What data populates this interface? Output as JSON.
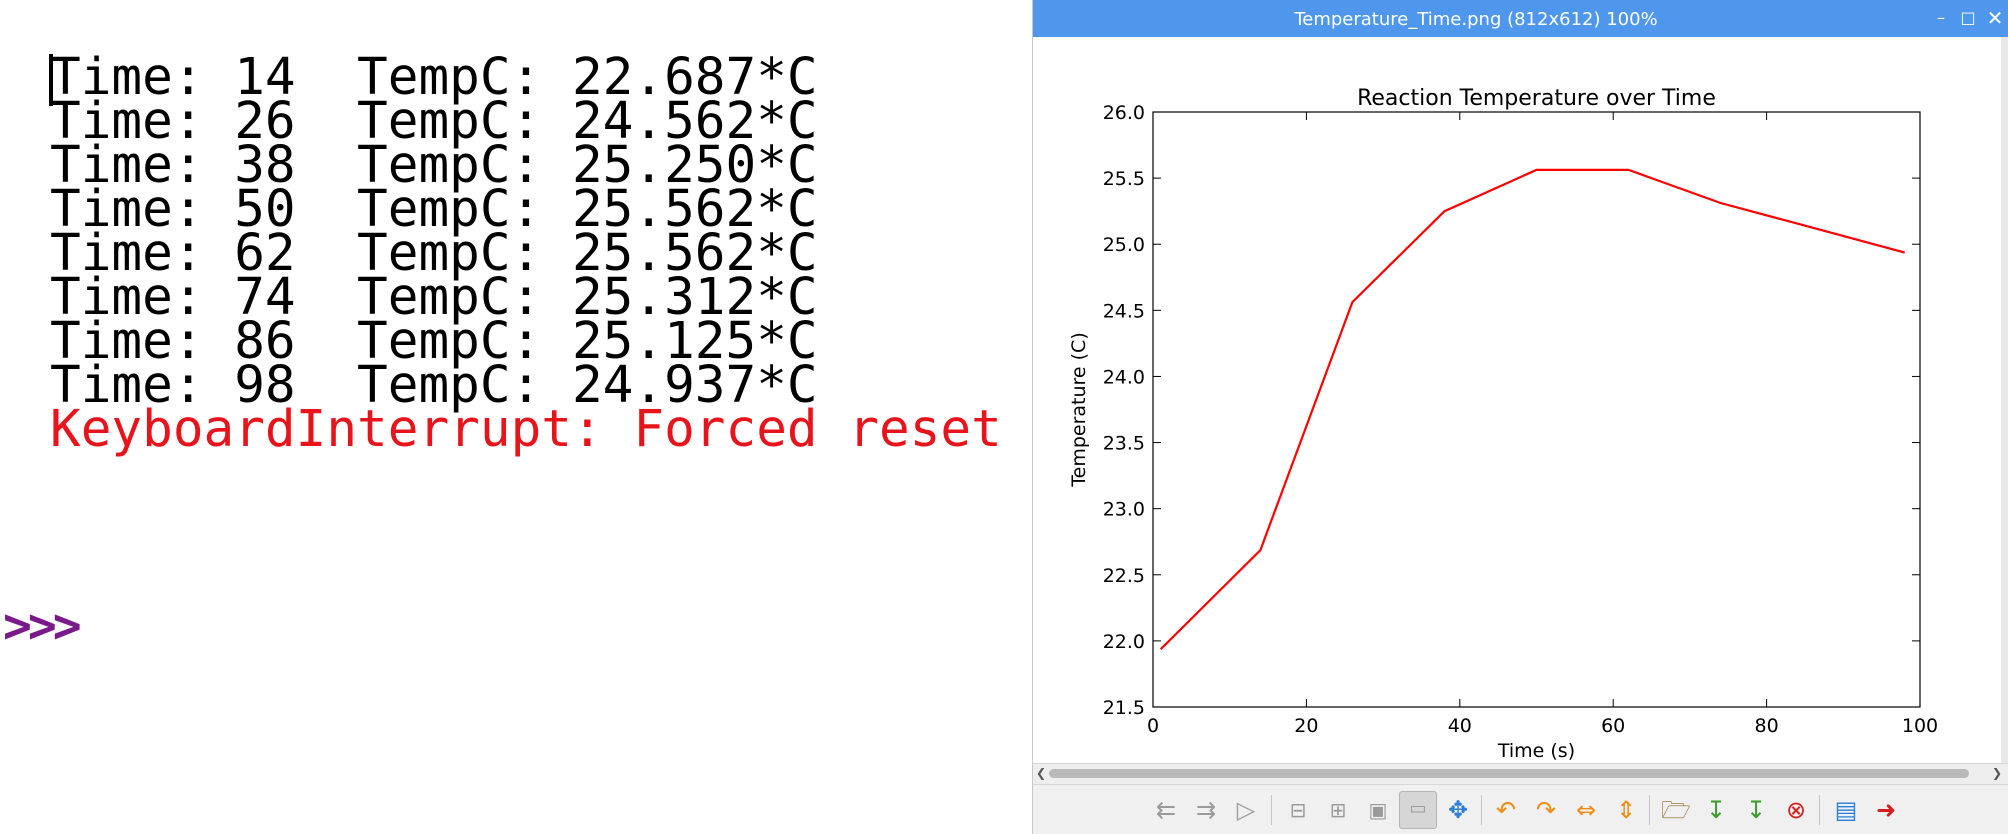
{
  "shell": {
    "lines": [
      "Time: 14  TempC: 22.687*C",
      "Time: 26  TempC: 24.562*C",
      "Time: 38  TempC: 25.250*C",
      "Time: 50  TempC: 25.562*C",
      "Time: 62  TempC: 25.562*C",
      "Time: 74  TempC: 25.312*C",
      "Time: 86  TempC: 25.125*C",
      "Time: 98  TempC: 24.937*C"
    ],
    "error": "KeyboardInterrupt: Forced reset",
    "prompt": ">>>",
    "colors": {
      "text": "#000000",
      "error": "#e8141c",
      "prompt": "#7a1a8a"
    }
  },
  "viewer": {
    "title": "Temperature_Time.png (812x612) 100%",
    "controls": {
      "minimize": "–",
      "maximize": "□",
      "close": "✕"
    },
    "titlebar_color": "#4e97ec",
    "toolbar": {
      "icons": [
        "previous-icon",
        "next-icon",
        "slideshow-icon",
        "zoom-out-icon",
        "zoom-in-icon",
        "zoom-fit-icon",
        "original-size-icon",
        "fullscreen-icon",
        "rotate-left-icon",
        "rotate-right-icon",
        "flip-horizontal-icon",
        "flip-vertical-icon",
        "open-file-icon",
        "save-file-icon",
        "save-as-icon",
        "delete-icon",
        "preferences-icon",
        "quit-icon"
      ]
    }
  },
  "chart_data": {
    "type": "line",
    "title": "Reaction Temperature over Time",
    "xlabel": "Time (s)",
    "ylabel": "Temperature (C)",
    "xlim": [
      0,
      100
    ],
    "ylim": [
      21.5,
      26.0
    ],
    "xticks": [
      "0",
      "20",
      "40",
      "60",
      "80",
      "100"
    ],
    "yticks": [
      "21.5",
      "22.0",
      "22.5",
      "23.0",
      "23.5",
      "24.0",
      "24.5",
      "25.0",
      "25.5",
      "26.0"
    ],
    "grid": false,
    "line_color": "#ff0000",
    "x": [
      1,
      14,
      26,
      38,
      50,
      62,
      74,
      86,
      98
    ],
    "y": [
      21.937,
      22.687,
      24.562,
      25.25,
      25.562,
      25.562,
      25.312,
      25.125,
      24.937
    ]
  }
}
